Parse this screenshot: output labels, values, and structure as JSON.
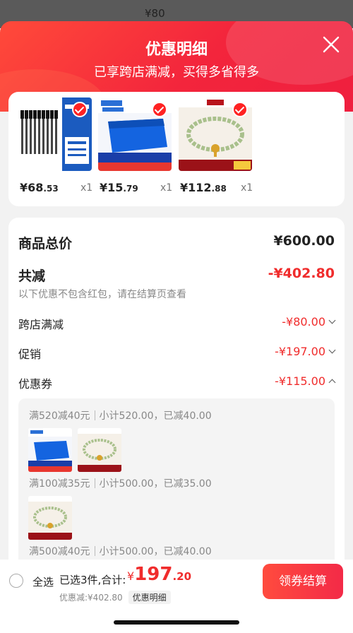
{
  "background": {
    "price": "¥80"
  },
  "header": {
    "title": "优惠明细",
    "subtitle": "已享跨店满减，买得多省得多",
    "close_icon": "close-icon"
  },
  "products": [
    {
      "name_icon": "pen-product-thumb",
      "price_int": "¥68",
      "price_dec": ".53",
      "qty": "x1"
    },
    {
      "name_icon": "blue-crate-product-thumb",
      "price_int": "¥15",
      "price_dec": ".79",
      "qty": "x1"
    },
    {
      "name_icon": "jade-bracelet-product-thumb",
      "price_int": "¥112",
      "price_dec": ".88",
      "qty": "x1"
    }
  ],
  "summary": {
    "total_label": "商品总价",
    "total_value": "¥600.00",
    "reduce_label": "共减",
    "reduce_value": "-¥402.80",
    "note": "以下优惠不包含红包，请在结算页查看",
    "cross_store_label": "跨店满减",
    "cross_store_value": "-¥80.00",
    "promo_label": "促销",
    "promo_value": "-¥197.00",
    "coupon_label": "优惠券",
    "coupon_value": "-¥115.00"
  },
  "coupons": [
    {
      "rule": "满520减40元",
      "subtotal": "小计520.00，已减40.00"
    },
    {
      "rule": "满100减35元",
      "subtotal": "小计500.00，已减35.00"
    },
    {
      "rule": "满500减40元",
      "subtotal": "小计500.00，已减40.00"
    }
  ],
  "bottom_bar": {
    "select_all": "全选",
    "chosen": "已选3件,合计:",
    "total_currency": "¥",
    "total_int": "197",
    "total_dec": ".20",
    "discount_line": "优惠减:¥402.80",
    "detail_tag": "优惠明细",
    "pay_button": "领券结算"
  },
  "colors": {
    "accent": "#f02c2c",
    "header_start": "#ff4a3a",
    "header_end": "#ef1f3f"
  }
}
